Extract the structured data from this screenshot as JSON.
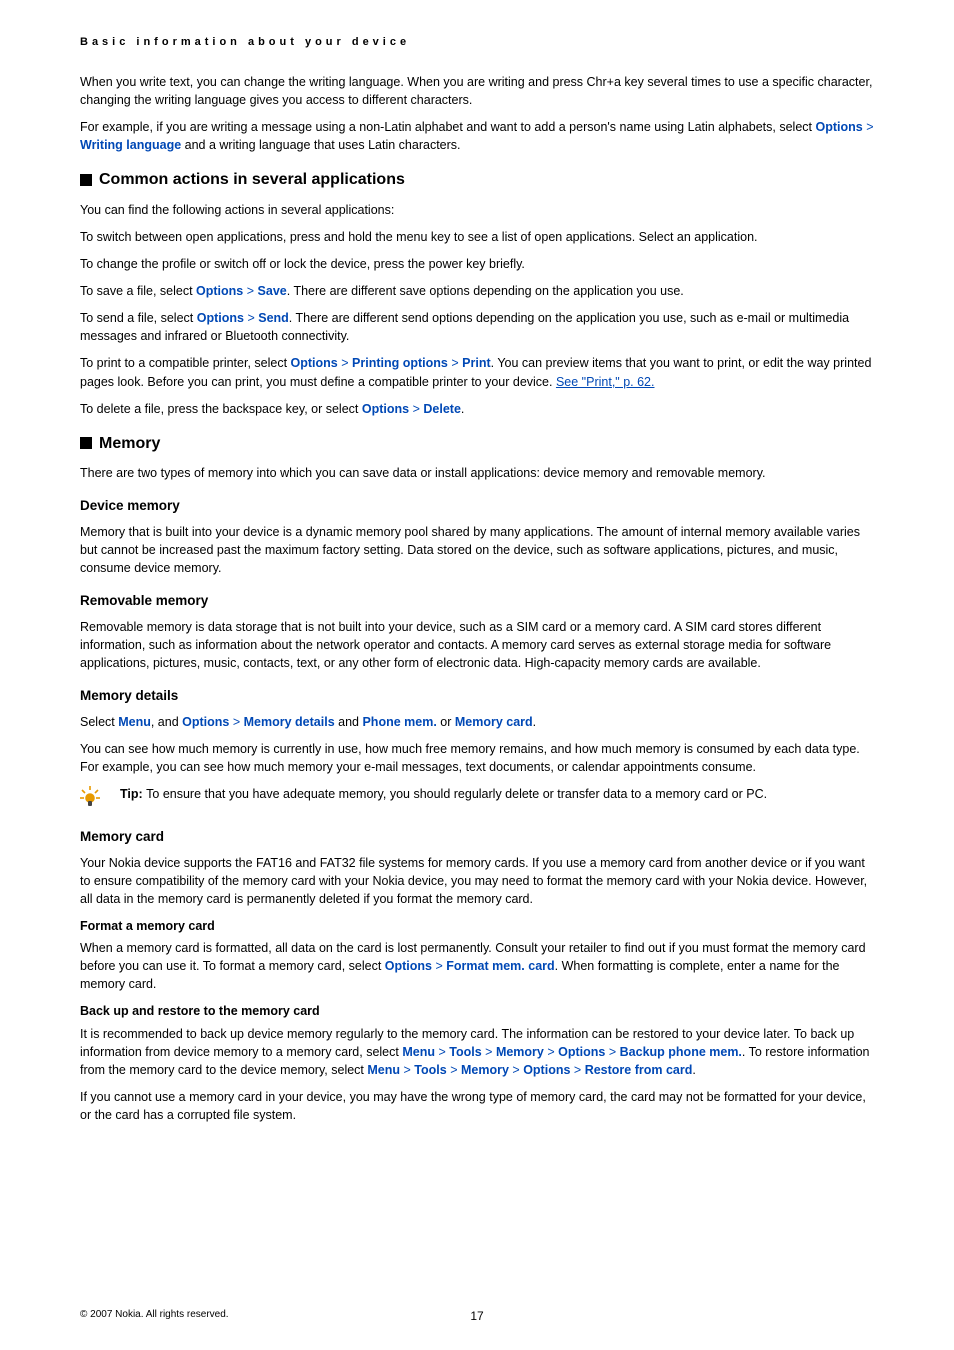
{
  "header": {
    "title": "Basic information about your device"
  },
  "intro": {
    "p1_a": "When you write text, you can change the writing language. When you are writing and press Chr+a key several times to use a specific character, changing the writing language gives you access to different characters.",
    "p2_a": "For example, if you are writing a message using a non-Latin alphabet and want to add a person's name using Latin alphabets, select ",
    "options": "Options",
    "writing_language": "Writing language",
    "p2_b": " and a writing language that uses Latin characters."
  },
  "common": {
    "title": "Common actions in several applications",
    "p1": "You can find the following actions in several applications:",
    "p2": "To switch between open applications, press and hold the menu key to see a list of open applications. Select an application.",
    "p3": "To change the profile or switch off or lock the device, press the power key briefly.",
    "save_a": "To save a file, select ",
    "save_lbl": "Save",
    "save_b": ". There are different save options depending on the application you use.",
    "send_a": "To send a file, select ",
    "send_lbl": "Send",
    "send_b": ". There are different send options depending on the application you use, such as e-mail or multimedia messages and infrared or Bluetooth connectivity.",
    "print_a": "To print to a compatible printer, select ",
    "printing_options": "Printing options",
    "print_lbl": "Print",
    "print_b": ". You can preview items that you want to print, or edit the way printed pages look. Before you can print, you must define a compatible printer to your device. ",
    "print_link": "See \"Print,\" p. 62.",
    "delete_a": "To delete a file, press the backspace key, or select ",
    "delete_lbl": "Delete",
    "options": "Options"
  },
  "memory": {
    "title": "Memory",
    "intro": "There are two types of memory into which you can save data or install applications: device memory and removable memory.",
    "device": {
      "title": "Device memory",
      "p1": "Memory that is built into your device is a dynamic memory pool shared by many applications. The amount of internal memory available varies but cannot be increased past the maximum factory setting. Data stored on the device, such as software applications, pictures, and music, consume device memory."
    },
    "removable": {
      "title": "Removable memory",
      "p1": "Removable memory is data storage that is not built into your device, such as a SIM card or a memory card. A SIM card stores different information, such as information about the network operator and contacts. A memory card serves as external storage media for software applications, pictures, music, contacts, text, or any other form of electronic data. High-capacity memory cards are available."
    },
    "details": {
      "title": "Memory details",
      "sel_a": "Select ",
      "menu": "Menu",
      "and_a": ", and ",
      "options": "Options",
      "memory_details": "Memory details",
      "and_b": " and ",
      "phone_mem": "Phone mem.",
      "or": " or ",
      "memory_card": "Memory card",
      "p2": "You can see how much memory is currently in use, how much free memory remains, and how much memory is consumed by each data type. For example, you can see how much memory your e-mail messages, text documents, or calendar appointments consume.",
      "tip_label": "Tip: ",
      "tip_text": "To ensure that you have adequate memory, you should regularly delete or transfer data to a memory card or PC."
    },
    "card": {
      "title": "Memory card",
      "p1": "Your Nokia device supports the FAT16 and FAT32 file systems for memory cards. If you use a memory card from another device or if you want to ensure compatibility of the memory card with your Nokia device, you may need to format the memory card with your Nokia device. However, all data in the memory card is permanently deleted if you format the memory card.",
      "format_title": "Format a memory card",
      "format_a": "When a memory card is formatted, all data on the card is lost permanently. Consult your retailer to find out if you must format the memory card before you can use it. To format a memory card, select ",
      "options": "Options",
      "format_mem": "Format mem. card",
      "format_b": ". When formatting is complete, enter a name for the memory card.",
      "backup_title": "Back up and restore to the memory card",
      "backup_a": "It is recommended to back up device memory regularly to the memory card. The information can be restored to your device later. To back up information from device memory to a memory card, select ",
      "menu": "Menu",
      "tools": "Tools",
      "memory": "Memory",
      "backup_phone": "Backup phone mem.",
      "backup_b": ". To restore information from the memory card to the device memory, select ",
      "restore": "Restore from card",
      "p_last": "If you cannot use a memory card in your device, you may have the wrong type of memory card, the card may not be formatted for your device, or the card has a corrupted file system."
    }
  },
  "footer": {
    "copyright": "© 2007 Nokia. All rights reserved.",
    "page": "17"
  }
}
